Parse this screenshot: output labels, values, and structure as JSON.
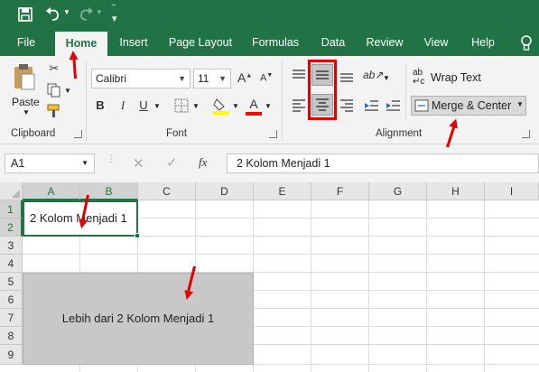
{
  "qat": {
    "save_icon": "save-icon",
    "undo_icon": "undo-icon",
    "redo_icon": "redo-icon",
    "customize_icon": "customize-qat-icon"
  },
  "tabs": [
    {
      "label": "File",
      "active": false
    },
    {
      "label": "Home",
      "active": true
    },
    {
      "label": "Insert",
      "active": false
    },
    {
      "label": "Page Layout",
      "active": false
    },
    {
      "label": "Formulas",
      "active": false
    },
    {
      "label": "Data",
      "active": false
    },
    {
      "label": "Review",
      "active": false
    },
    {
      "label": "View",
      "active": false
    },
    {
      "label": "Help",
      "active": false
    }
  ],
  "tell_me_icon": "lightbulb-icon",
  "clipboard": {
    "paste_label": "Paste",
    "group_label": "Clipboard"
  },
  "font": {
    "name": "Calibri",
    "size": "11",
    "bold": "B",
    "italic": "I",
    "underline": "U",
    "grow": "A",
    "shrink": "A",
    "color_letter": "A",
    "group_label": "Font",
    "fill_color": "#ffff00",
    "font_color": "#ff0000"
  },
  "alignment": {
    "wrap_label": "Wrap Text",
    "merge_label": "Merge & Center",
    "group_label": "Alignment"
  },
  "formula_bar": {
    "name_box": "A1",
    "fx": "fx",
    "value": "2 Kolom Menjadi 1"
  },
  "columns": [
    "A",
    "B",
    "C",
    "D",
    "E",
    "F",
    "G",
    "H",
    "I"
  ],
  "rows": [
    "1",
    "2",
    "3",
    "4",
    "5",
    "6",
    "7",
    "8",
    "9"
  ],
  "cells": {
    "merged_a1": "2 Kolom Menjadi 1",
    "merged_a5": "Lebih dari 2 Kolom Menjadi 1"
  },
  "colors": {
    "excel_green": "#217346",
    "highlight_red": "#e00000",
    "merged_fill": "#c8c8c8"
  }
}
